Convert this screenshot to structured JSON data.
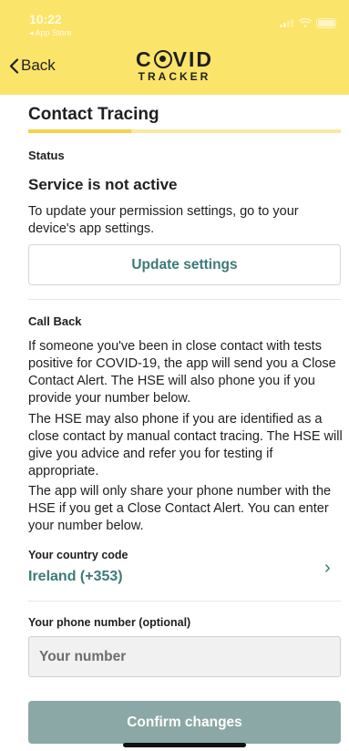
{
  "status_bar": {
    "time": "10:22",
    "back_app": "◂ App Store"
  },
  "header": {
    "back_label": "Back",
    "logo_main_left": "C",
    "logo_main_right": "VID",
    "logo_sub": "TRACKER",
    "background_color": "#fbe46a"
  },
  "page": {
    "title": "Contact Tracing",
    "progress_fraction": 0.33
  },
  "status_section": {
    "label": "Status",
    "state": "Service is not active",
    "description": "To update your permission settings, go to your device's app settings.",
    "update_button": "Update settings"
  },
  "callback_section": {
    "label": "Call Back",
    "paragraphs": [
      "If someone you've been in close contact with tests positive for COVID-19, the app will send you a Close Contact Alert.  The HSE will also phone you if you provide your number below.",
      "The HSE may also phone if you are identified as a close contact by manual contact tracing. The HSE will give you advice and refer you for testing if appropriate.",
      "The app will only share your phone number with the HSE if you get a Close Contact Alert. You can enter your number below."
    ]
  },
  "country": {
    "label": "Your country code",
    "value": "Ireland (+353)"
  },
  "phone": {
    "label": "Your phone number (optional)",
    "placeholder": "Your number"
  },
  "confirm_button": "Confirm changes",
  "colors": {
    "accent": "#3d7a78",
    "primary_button": "#8ca8a6",
    "header": "#fbe46a"
  }
}
